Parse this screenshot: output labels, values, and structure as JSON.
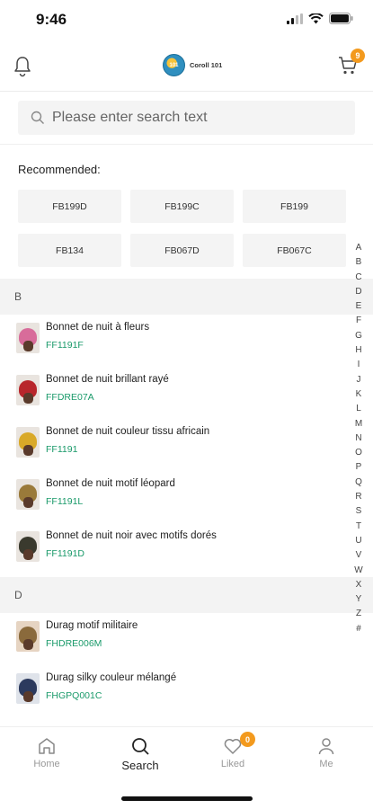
{
  "status": {
    "time": "9:46"
  },
  "header": {
    "brand_name": "Coroll 101",
    "brand_logo_text": "101",
    "cart_count": "9"
  },
  "search": {
    "placeholder": "Please enter search text"
  },
  "recommended": {
    "title": "Recommended:",
    "items": [
      "FB199D",
      "FB199C",
      "FB199",
      "FB134",
      "FB067D",
      "FB067C"
    ]
  },
  "sections": [
    {
      "letter": "B",
      "items": [
        {
          "name": "Bonnet de nuit à fleurs",
          "code": "FF1191F"
        },
        {
          "name": "Bonnet de nuit brillant rayé",
          "code": "FFDRE07A"
        },
        {
          "name": "Bonnet de nuit couleur tissu africain",
          "code": "FF1191"
        },
        {
          "name": "Bonnet de nuit motif léopard",
          "code": "FF1191L"
        },
        {
          "name": "Bonnet de nuit noir avec motifs dorés",
          "code": "FF1191D"
        }
      ]
    },
    {
      "letter": "D",
      "items": [
        {
          "name": "Durag motif militaire",
          "code": "FHDRE006M"
        },
        {
          "name": "Durag silky couleur mélangé",
          "code": "FHGPQ001C"
        }
      ]
    }
  ],
  "alphabet": [
    "A",
    "B",
    "C",
    "D",
    "E",
    "F",
    "G",
    "H",
    "I",
    "J",
    "K",
    "L",
    "M",
    "N",
    "O",
    "P",
    "Q",
    "R",
    "S",
    "T",
    "U",
    "V",
    "W",
    "X",
    "Y",
    "Z",
    "#"
  ],
  "nav": {
    "home": "Home",
    "search": "Search",
    "liked": "Liked",
    "liked_count": "0",
    "me": "Me"
  },
  "colors": {
    "accent": "#f39a1e",
    "code_green": "#1a9a6a"
  }
}
